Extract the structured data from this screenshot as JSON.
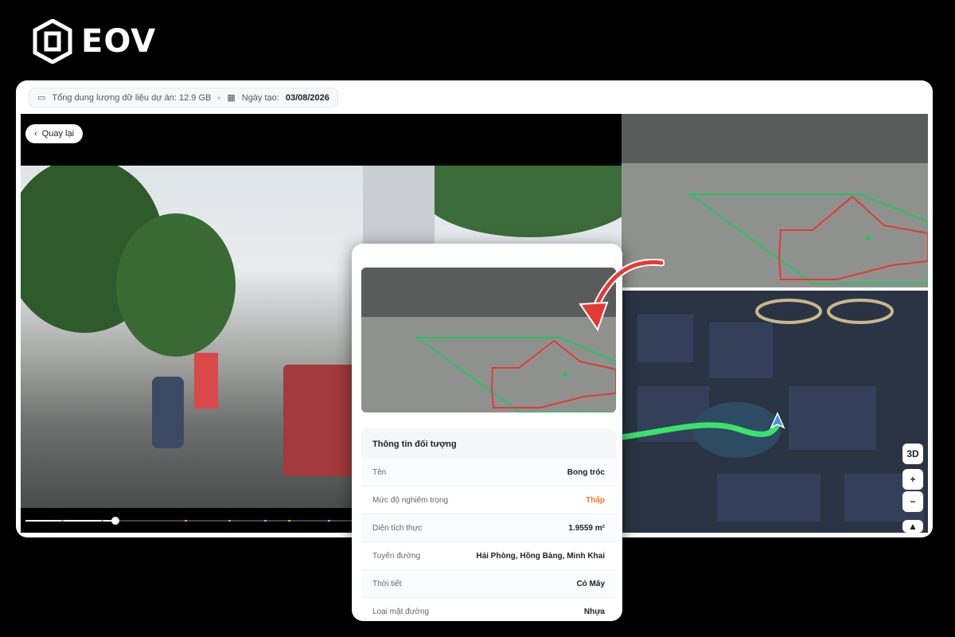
{
  "brand": {
    "name": "EOV"
  },
  "header": {
    "storage_label": "Tổng dung lượng dữ liệu dự án: 12.9 GB",
    "date_label": "Ngày tạo:",
    "date_value": "03/08/2026"
  },
  "video": {
    "back_label": "Quay lại",
    "progress": 0.27
  },
  "map": {
    "mode_label": "3D",
    "zoom_in": "+",
    "zoom_out": "−",
    "north": "▲"
  },
  "details": {
    "title": "Thông tin đối tượng",
    "rows": [
      {
        "label": "Tên",
        "value": "Bong tróc"
      },
      {
        "label": "Mức độ nghiêm trọng",
        "value": "Thấp"
      },
      {
        "label": "Diện tích thực",
        "value": "1.9559 m²"
      },
      {
        "label": "Tuyến đường",
        "value": "Hải Phòng, Hồng Bàng, Minh Khai"
      },
      {
        "label": "Thời tiết",
        "value": "Có Mây"
      },
      {
        "label": "Loại mặt đường",
        "value": "Nhựa"
      }
    ]
  },
  "colors": {
    "severity_low": "#f07a2c",
    "detection_box": "#22c55e",
    "damage_outline": "#e53935",
    "route": "#3be36b",
    "arrow": "#e53935"
  }
}
